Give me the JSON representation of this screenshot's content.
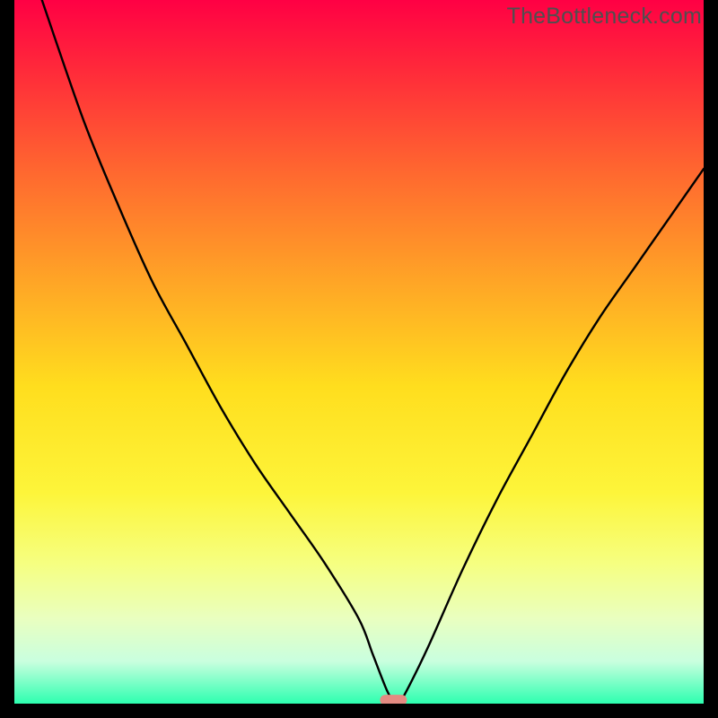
{
  "watermark": "TheBottleneck.com",
  "chart_data": {
    "type": "line",
    "title": "",
    "xlabel": "",
    "ylabel": "",
    "xlim": [
      0,
      100
    ],
    "ylim": [
      0,
      100
    ],
    "series": [
      {
        "name": "curve",
        "x": [
          4,
          10,
          15,
          20,
          25,
          30,
          35,
          40,
          45,
          50,
          52,
          54,
          55,
          56,
          57,
          60,
          65,
          70,
          75,
          80,
          85,
          90,
          95,
          100
        ],
        "y": [
          100,
          83,
          71,
          60,
          51,
          42,
          34,
          27,
          20,
          12,
          7,
          2,
          0.5,
          0.5,
          2,
          8,
          19,
          29,
          38,
          47,
          55,
          62,
          69,
          76
        ]
      }
    ],
    "marker": {
      "x": 55,
      "y": 0.5
    },
    "gradient_stops": [
      {
        "offset": 0.0,
        "color": "#ff0044"
      },
      {
        "offset": 0.1,
        "color": "#ff2a3a"
      },
      {
        "offset": 0.25,
        "color": "#ff6a2f"
      },
      {
        "offset": 0.4,
        "color": "#ffa526"
      },
      {
        "offset": 0.55,
        "color": "#ffde1e"
      },
      {
        "offset": 0.7,
        "color": "#fdf53a"
      },
      {
        "offset": 0.8,
        "color": "#f6ff80"
      },
      {
        "offset": 0.88,
        "color": "#e9ffc0"
      },
      {
        "offset": 0.94,
        "color": "#c9ffdf"
      },
      {
        "offset": 1.0,
        "color": "#2dffb0"
      }
    ]
  }
}
